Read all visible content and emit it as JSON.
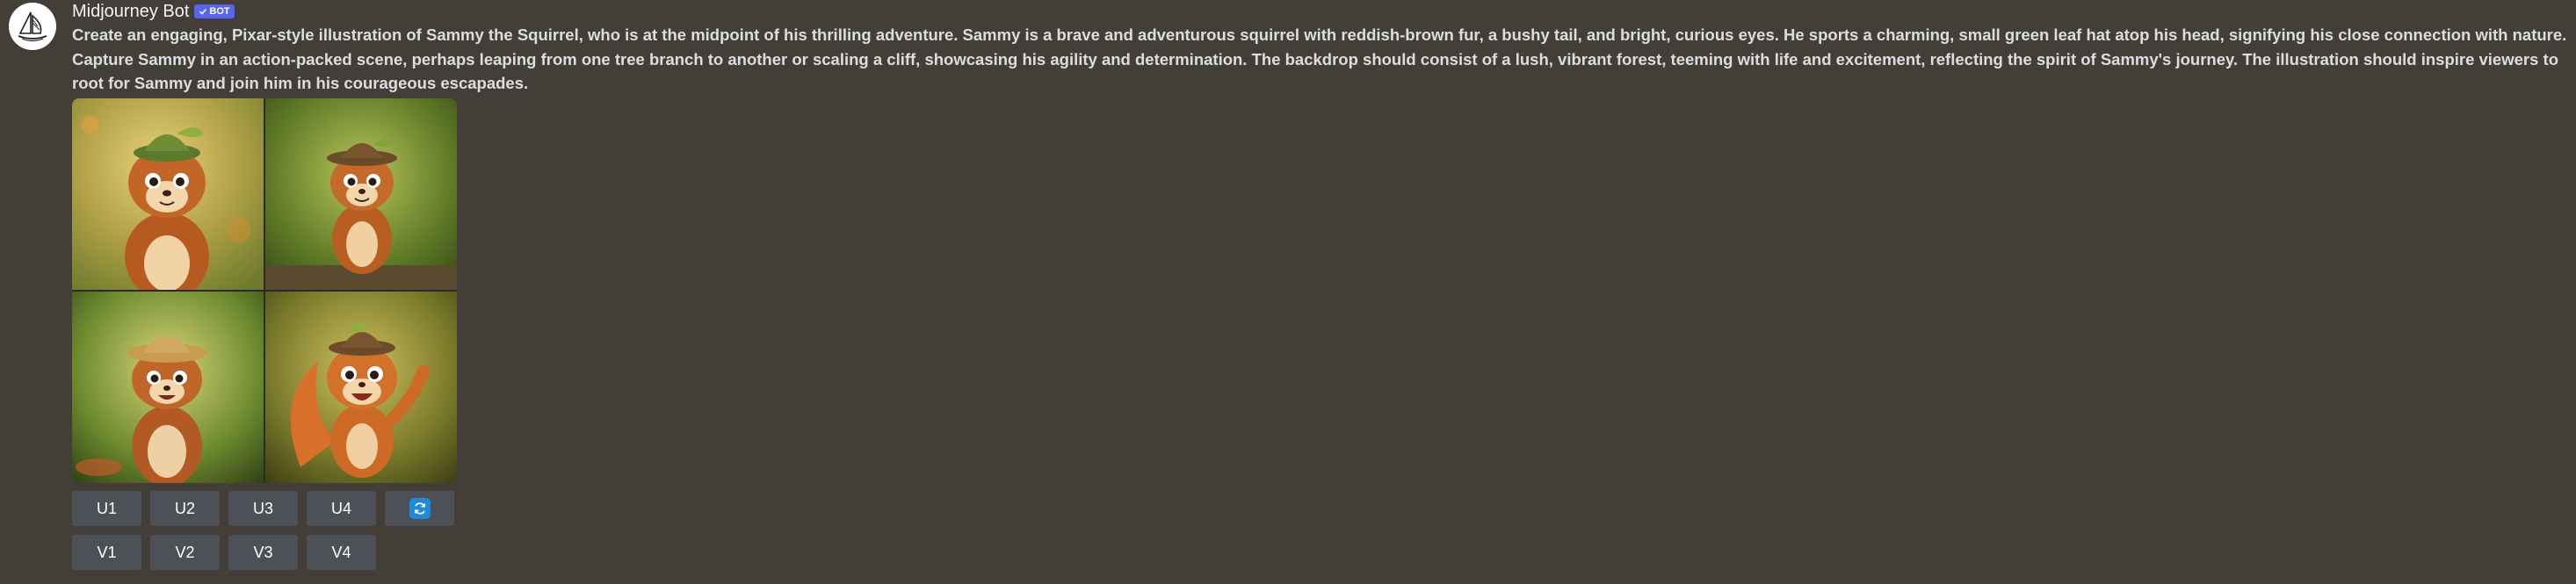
{
  "message": {
    "author": "Midjourney Bot",
    "badge": "BOT",
    "prompt": "Create an engaging, Pixar-style illustration of Sammy the Squirrel, who is at the midpoint of his thrilling adventure. Sammy is a brave and adventurous squirrel with reddish-brown fur, a bushy tail, and bright, curious eyes. He sports a charming, small green leaf hat atop his head, signifying his close connection with nature. Capture Sammy in an action-packed scene, perhaps leaping from one tree branch to another or scaling a cliff, showcasing his agility and determination. The backdrop should consist of a lush, vibrant forest, teeming with life and excitement, reflecting the spirit of Sammy's journey. The illustration should inspire viewers to root for Sammy and join him in his courageous escapades."
  },
  "upscale_buttons": [
    "U1",
    "U2",
    "U3",
    "U4"
  ],
  "variation_buttons": [
    "V1",
    "V2",
    "V3",
    "V4"
  ],
  "icons": {
    "avatar": "sailboat-icon",
    "badge_check": "checkmark-icon",
    "reroll": "refresh-icon"
  },
  "colors": {
    "background": "#433f38",
    "button": "#4e5058",
    "badge": "#5865f2",
    "reroll": "#1f8ad8"
  }
}
